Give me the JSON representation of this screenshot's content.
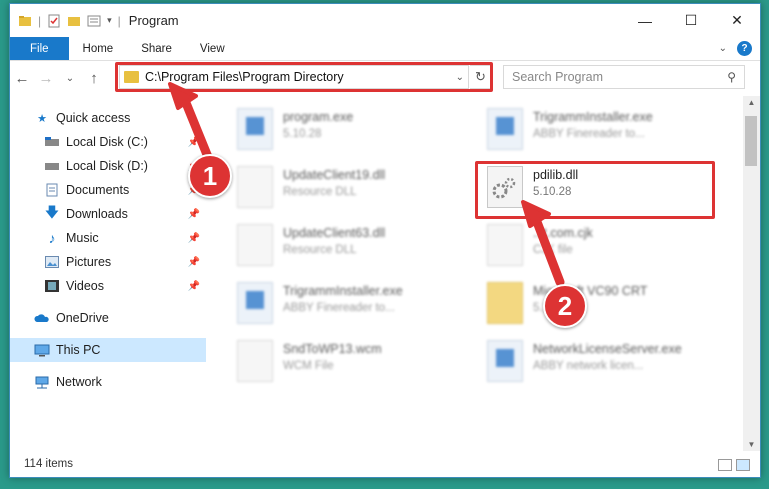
{
  "window": {
    "title": "Program"
  },
  "window_controls": {
    "minimize": "—",
    "maximize": "☐",
    "close": "✕"
  },
  "ribbon": {
    "tabs": [
      {
        "label": "File"
      },
      {
        "label": "Home"
      },
      {
        "label": "Share"
      },
      {
        "label": "View"
      }
    ],
    "help": "?"
  },
  "nav": {
    "address_path": "C:\\Program Files\\Program Directory",
    "search_placeholder": "Search Program"
  },
  "sidebar": {
    "items": [
      {
        "label": "Quick access"
      },
      {
        "label": "Local Disk (C:)"
      },
      {
        "label": "Local Disk (D:)"
      },
      {
        "label": "Documents"
      },
      {
        "label": "Downloads"
      },
      {
        "label": "Music"
      },
      {
        "label": "Pictures"
      },
      {
        "label": "Videos"
      },
      {
        "label": "OneDrive"
      },
      {
        "label": "This PC"
      },
      {
        "label": "Network"
      }
    ]
  },
  "files": [
    {
      "name": "program.exe",
      "sub": "5.10.28"
    },
    {
      "name": "TrigrammInstaller.exe",
      "sub": "ABBY Finereader to..."
    },
    {
      "name": "UpdateClient19.dll",
      "sub": "Resource DLL"
    },
    {
      "name": "pdilib.dll",
      "sub": "5.10.28"
    },
    {
      "name": "UpdateClient63.dll",
      "sub": "Resource DLL"
    },
    {
      "name": "...t.com.cjk",
      "sub": "CJK file"
    },
    {
      "name": "TrigrammInstaller.exe",
      "sub": "ABBY Finereader to..."
    },
    {
      "name": "Microsoft VC90 CRT",
      "sub": "5.1..."
    },
    {
      "name": "SndToWP13.wcm",
      "sub": "WCM File"
    },
    {
      "name": "NetworkLicenseServer.exe",
      "sub": "ABBY network licen..."
    }
  ],
  "status": {
    "item_count": "114 items"
  },
  "callouts": {
    "step1": "1",
    "step2": "2"
  },
  "colors": {
    "accent": "#1979ca",
    "highlight": "#dd3333",
    "selected": "#cce8ff"
  }
}
